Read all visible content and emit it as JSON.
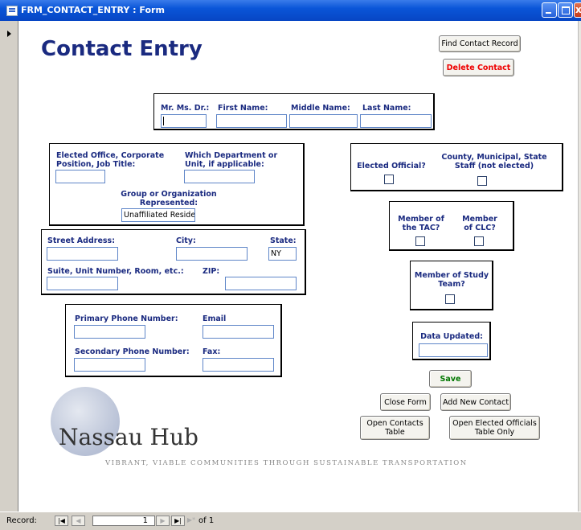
{
  "window": {
    "title": "FRM_CONTACT_ENTRY : Form"
  },
  "form": {
    "heading": "Contact Entry",
    "buttons": {
      "find": "Find Contact Record",
      "delete": "Delete Contact",
      "save": "Save",
      "close": "Close Form",
      "add_new": "Add New Contact",
      "open_contacts": "Open Contacts Table",
      "open_elected": "Open Elected Officials Table Only"
    },
    "name": {
      "prefix_label": "Mr. Ms. Dr.:",
      "first_label": "First Name:",
      "middle_label": "Middle Name:",
      "last_label": "Last Name:",
      "prefix_value": "",
      "first_value": "",
      "middle_value": "",
      "last_value": ""
    },
    "office": {
      "position_label": "Elected Office, Corporate Position, Job Title:",
      "department_label": "Which Department or Unit, if applicable:",
      "group_label": "Group or Organization Represented:",
      "group_value": "Unaffiliated Resider"
    },
    "address": {
      "street_label": "Street Address:",
      "city_label": "City:",
      "state_label": "State:",
      "state_value": "NY",
      "suite_label": "Suite, Unit Number, Room, etc.:",
      "zip_label": "ZIP:"
    },
    "contact": {
      "primary_phone_label": "Primary Phone Number:",
      "email_label": "Email",
      "secondary_phone_label": "Secondary Phone Number:",
      "fax_label": "Fax:"
    },
    "flags": {
      "elected_label": "Elected Official?",
      "staff_label": "County, Municipal, State Staff (not elected)",
      "tac_label": "Member of the TAC?",
      "clc_label": "Member of CLC?",
      "study_label": "Member of Study Team?",
      "elected_checked": false,
      "staff_checked": false,
      "tac_checked": false,
      "clc_checked": false,
      "study_checked": false
    },
    "data_updated_label": "Data Updated:",
    "data_updated_value": ""
  },
  "logo": {
    "name": "Nassau Hub",
    "tagline": "VIBRANT, VIABLE COMMUNITIES THROUGH SUSTAINABLE TRANSPORTATION"
  },
  "navigation": {
    "record_label": "Record:",
    "current": "1",
    "of_text": "of 1",
    "first_icon": "first-record-icon",
    "prev_icon": "previous-record-icon",
    "next_icon": "next-record-icon",
    "last_icon": "last-record-icon",
    "new_icon": "new-record-icon"
  },
  "colors": {
    "heading": "#1a2a80",
    "label": "#1a2a80",
    "delete": "#e00000",
    "save": "#007700",
    "titlebar": "#0a55d8"
  }
}
